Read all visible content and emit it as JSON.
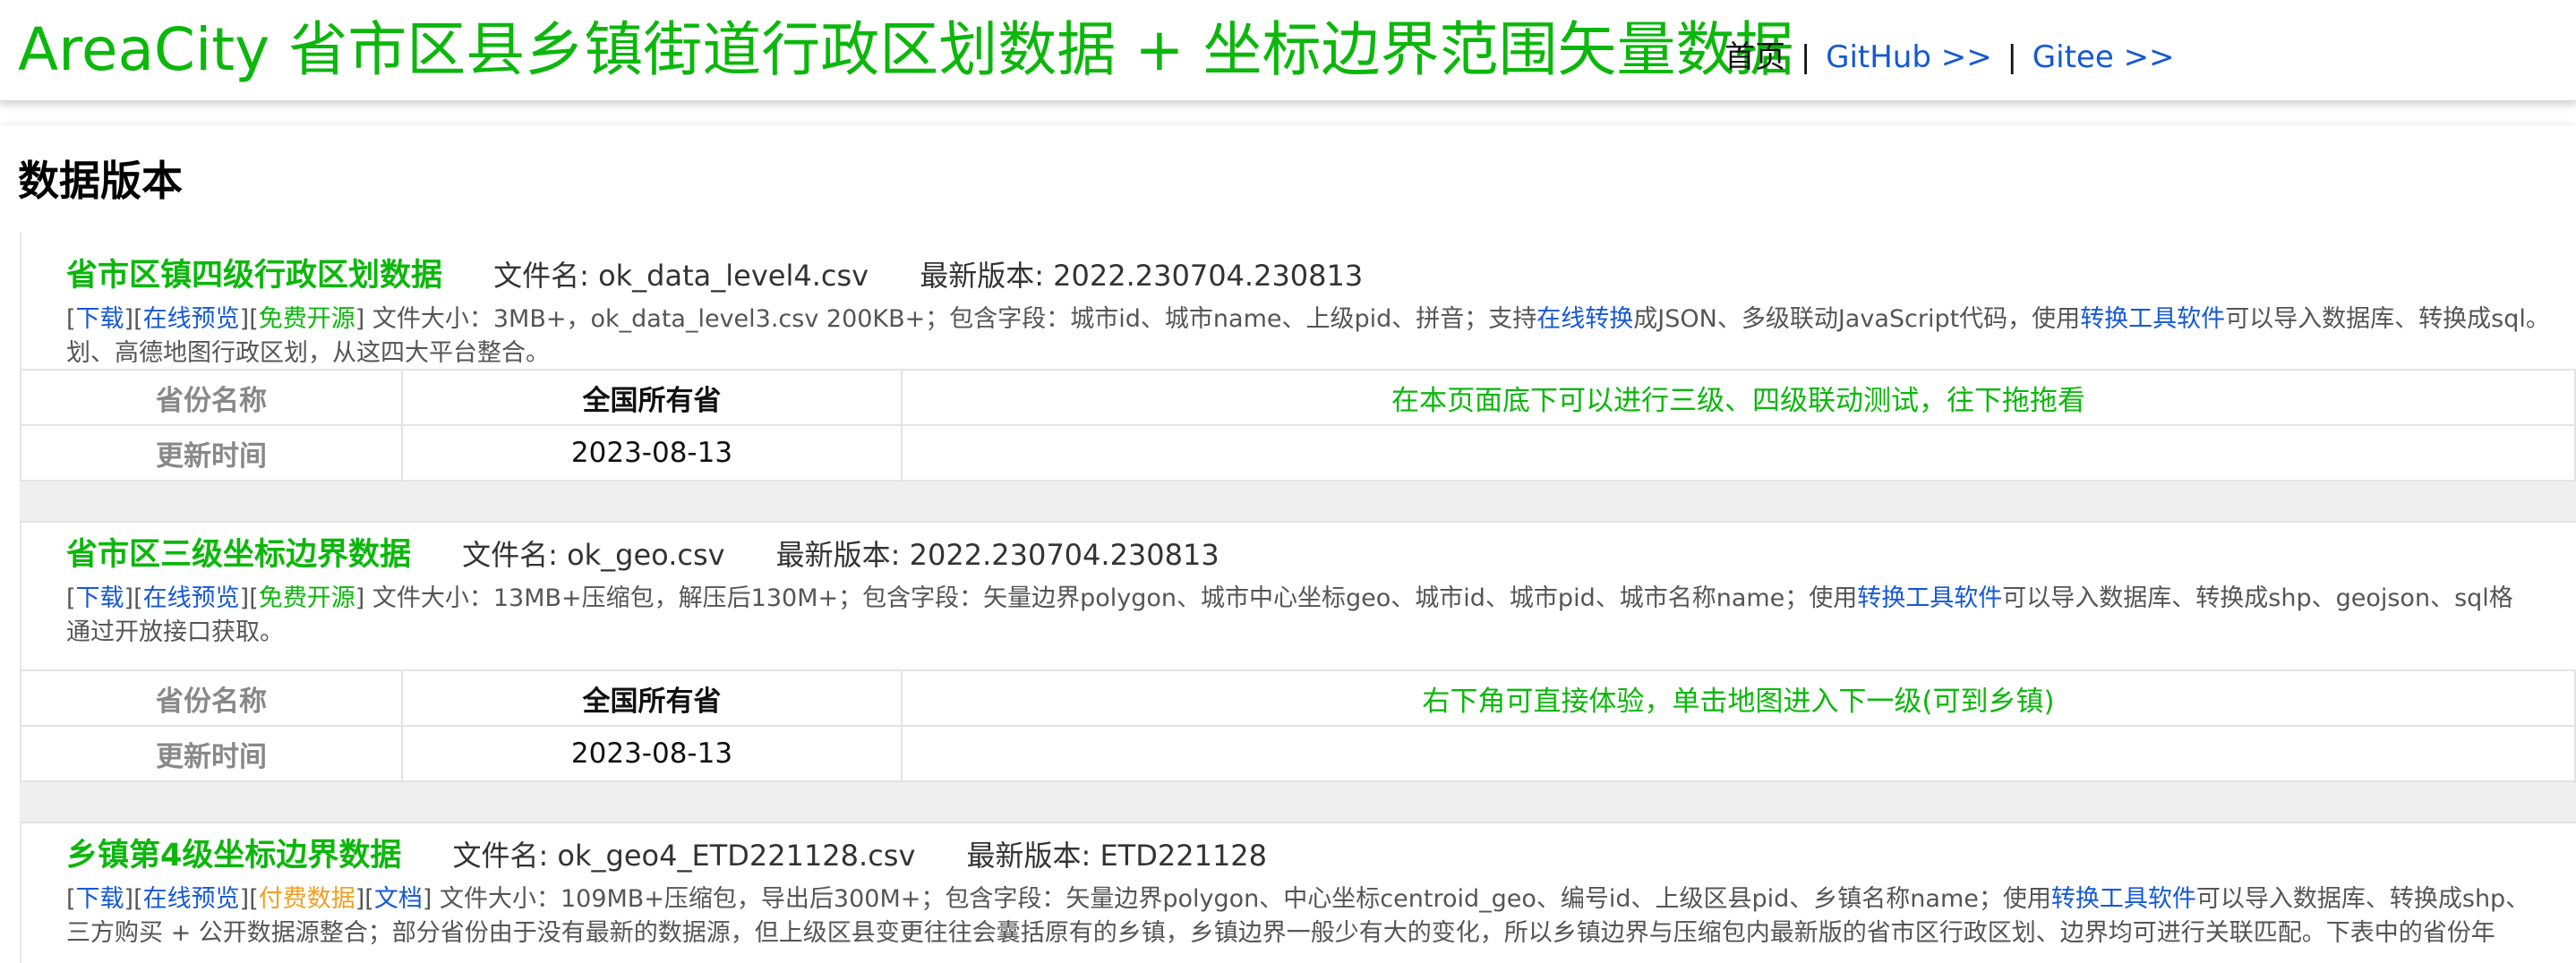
{
  "header": {
    "title": "AreaCity 省市区县乡镇街道行政区划数据 + 坐标边界范围矢量数据",
    "nav_home": "首页",
    "nav_sep1": "|",
    "nav_github": "GitHub >>",
    "nav_sep2": "|",
    "nav_gitee": "Gitee >>"
  },
  "section": {
    "title": "数据版本"
  },
  "blocks": [
    {
      "name": "省市区镇四级行政区划数据",
      "file": "文件名: ok_data_level4.csv",
      "version": "最新版本: 2022.230704.230813",
      "links": {
        "download": "下载",
        "preview": "在线预览",
        "free": "免费开源"
      },
      "desc_a": " 文件大小：3MB+，ok_data_level3.csv 200KB+；包含字段：城市id、城市name、上级pid、拼音；支持",
      "desc_link1": "在线转换",
      "desc_b": "成JSON、多级联动JavaScript代码，使用",
      "desc_link2": "转换工具软件",
      "desc_c": "可以导入数据库、转换成sql。",
      "desc_line2": "划、高德地图行政区划，从这四大平台整合。",
      "table": {
        "label1": "省份名称",
        "value1": "全国所有省",
        "note": "在本页面底下可以进行三级、四级联动测试，往下拖拖看",
        "label2": "更新时间",
        "value2": "2023-08-13"
      }
    },
    {
      "name": "省市区三级坐标边界数据",
      "file": "文件名: ok_geo.csv",
      "version": "最新版本: 2022.230704.230813",
      "links": {
        "download": "下载",
        "preview": "在线预览",
        "free": "免费开源"
      },
      "desc_a": " 文件大小：13MB+压缩包，解压后130M+；包含字段：矢量边界polygon、城市中心坐标geo、城市id、城市pid、城市名称name；使用",
      "desc_link2": "转换工具软件",
      "desc_c": "可以导入数据库、转换成shp、geojson、sql格",
      "desc_line2": "通过开放接口获取。",
      "table": {
        "label1": "省份名称",
        "value1": "全国所有省",
        "note": "右下角可直接体验，单击地图进入下一级(可到乡镇)",
        "label2": "更新时间",
        "value2": "2023-08-13"
      }
    },
    {
      "name": "乡镇第4级坐标边界数据",
      "file": "文件名: ok_geo4_ETD221128.csv",
      "version": "最新版本: ETD221128",
      "links": {
        "download": "下载",
        "preview": "在线预览",
        "paid": "付费数据",
        "docs": "文档"
      },
      "desc_a": " 文件大小：109MB+压缩包，导出后300M+；包含字段：矢量边界polygon、中心坐标centroid_geo、编号id、上级区县pid、乡镇名称name；使用",
      "desc_link2": "转换工具软件",
      "desc_c": "可以导入数据库、转换成shp、",
      "desc_line2": "三方购买 + 公开数据源整合；部分省份由于没有最新的数据源，但上级区县变更往往会囊括原有的乡镇，乡镇边界一般少有大的变化，所以乡镇边界与压缩包内最新版的省市区行政区划、边界均可进行关联匹配。下表中的省份年"
    }
  ],
  "colors": {
    "brand_green": "#0bb70b",
    "link_blue": "#1558d6",
    "paid_orange": "#f0a020"
  }
}
